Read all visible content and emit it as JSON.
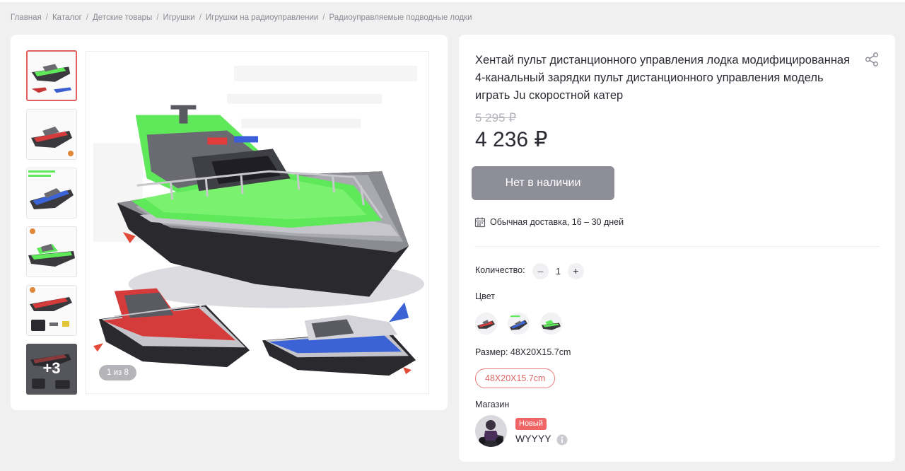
{
  "breadcrumb": {
    "items": [
      "Главная",
      "Каталог",
      "Детские товары",
      "Игрушки",
      "Игрушки на радиоуправлении",
      "Радиоуправляемые подводные лодки"
    ],
    "separator": "/"
  },
  "gallery": {
    "thumbnails": [
      {
        "icon": "green-boat-thumbnail",
        "active": true
      },
      {
        "icon": "red-boat-thumbnail"
      },
      {
        "icon": "blue-boat-thumbnail"
      },
      {
        "icon": "green-boat-side-thumbnail"
      },
      {
        "icon": "red-boat-with-remote-thumbnail"
      }
    ],
    "more_label": "+3",
    "counter": "1 из 8"
  },
  "product": {
    "title": "Хентай пульт дистанционного управления лодка модифицированная 4-канальный зарядки пульт дистанционного управления модель играть Ju скоростной катер",
    "old_price": "5 295 ₽",
    "price": "4 236 ₽",
    "stock_button": "Нет в наличии",
    "delivery": "Обычная доставка, 16 – 30 дней",
    "quantity_label": "Количество:",
    "quantity_minus": "–",
    "quantity_value": "1",
    "quantity_plus": "+",
    "color_label": "Цвет",
    "colors": [
      "red",
      "blue",
      "green"
    ],
    "size_label": "Размер: 48X20X15.7cm",
    "size_option": "48X20X15.7cm",
    "shop_label": "Магазин",
    "shop_badge": "Новый",
    "shop_name": "WYYYY"
  },
  "colors": {
    "accent": "#e35e5e",
    "disabled_button": "#8e8e99",
    "boat_green": "#5ee85a",
    "boat_red": "#d63b3b",
    "boat_blue": "#3b63d6"
  }
}
